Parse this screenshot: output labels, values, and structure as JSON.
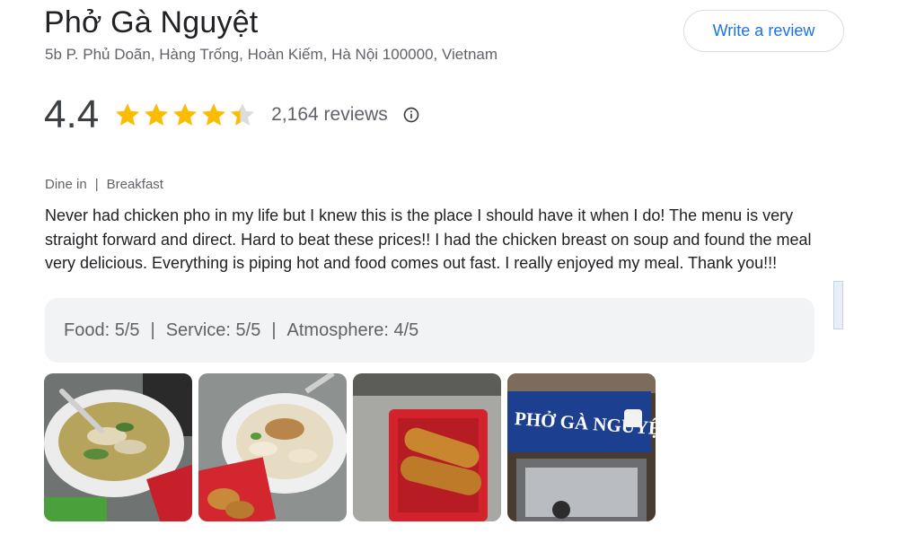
{
  "place": {
    "name": "Phở Gà Nguyệt",
    "address": "5b P. Phủ Doãn, Hàng Trống, Hoàn Kiếm, Hà Nội 100000, Vietnam"
  },
  "actions": {
    "write_review": "Write a review"
  },
  "rating": {
    "value": "4.4",
    "stars": 4.4,
    "reviews": "2,164 reviews",
    "star_color": "#fbbc04",
    "empty_star_color": "#dadce0"
  },
  "review": {
    "tags": [
      "Dine in",
      "Breakfast"
    ],
    "text": "Never had chicken pho in my life but I knew this is the place I should have it when I do! The menu is very straight forward and direct. Hard to beat these prices!! I had the chicken breast on soup and found the meal very delicious. Everything is piping hot and food comes out fast. I really enjoyed my meal. Thank you!!!",
    "scores": [
      "Food: 5/5",
      "Service: 5/5",
      "Atmosphere: 4/5"
    ]
  },
  "photos": [
    {
      "name": "photo-pho-bowl"
    },
    {
      "name": "photo-chicken-bowl"
    },
    {
      "name": "photo-fried-dough"
    },
    {
      "name": "photo-storefront",
      "sign_text": "PHỞ GÀ NGUYỆT"
    }
  ],
  "icons": {
    "info": "info-icon",
    "star": "star-icon"
  }
}
